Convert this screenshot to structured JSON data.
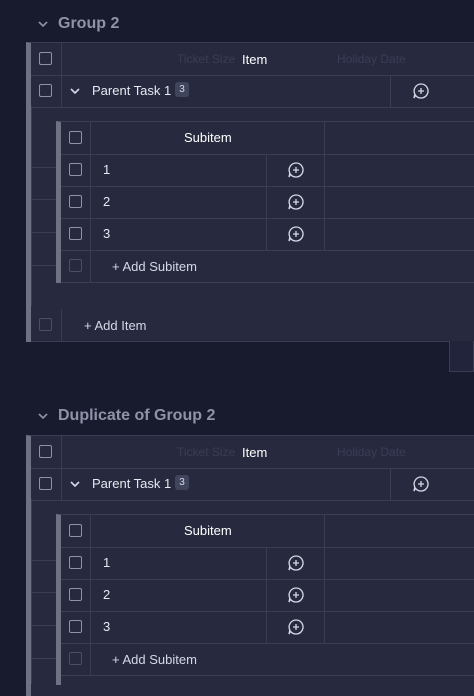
{
  "groups": [
    {
      "title": "Group 2",
      "header": {
        "item": "Item",
        "ghost1": "Ticket Size",
        "ghost2": "Holiday Date"
      },
      "parent": {
        "label": "Parent Task 1",
        "count": "3"
      },
      "sub_header": "Subitem",
      "subitems": [
        "1",
        "2",
        "3"
      ],
      "add_subitem": "+ Add Subitem",
      "add_item": "+ Add Item"
    },
    {
      "title": "Duplicate of Group 2",
      "header": {
        "item": "Item",
        "ghost1": "Ticket Size",
        "ghost2": "Holiday Date"
      },
      "parent": {
        "label": "Parent Task 1",
        "count": "3"
      },
      "sub_header": "Subitem",
      "subitems": [
        "1",
        "2",
        "3"
      ],
      "add_subitem": "+ Add Subitem"
    }
  ],
  "icons": {
    "collapse": "chevron-down-icon",
    "add_update": "add-update-icon"
  }
}
